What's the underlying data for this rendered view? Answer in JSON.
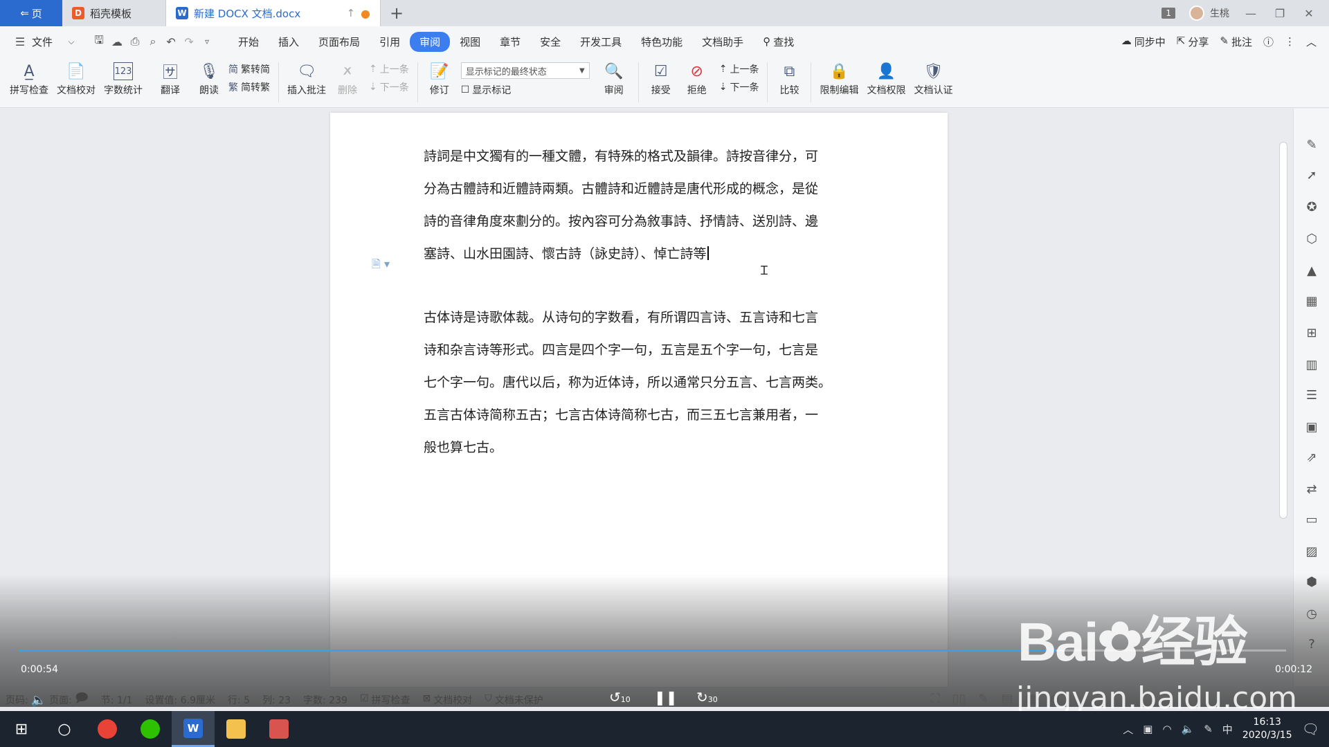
{
  "titlebar": {
    "home_tab": "页",
    "tabs": [
      {
        "label": "稻壳模板",
        "logo": "D"
      },
      {
        "label": "新建 DOCX 文档.docx",
        "logo": "W"
      }
    ],
    "add_tab": "+",
    "page_count_badge": "1",
    "user_name": "生桃",
    "window_minimize": "—",
    "window_restore": "❐",
    "window_close": "✕"
  },
  "menubar": {
    "file_label": "文件",
    "items": [
      "开始",
      "插入",
      "页面布局",
      "引用",
      "审阅",
      "视图",
      "章节",
      "安全",
      "开发工具",
      "特色功能",
      "文档助手"
    ],
    "active": "审阅",
    "search_label": "查找",
    "right": {
      "sync": "同步中",
      "share": "分享",
      "comment": "批注"
    }
  },
  "ribbon": {
    "spell_check": "拼写检查",
    "doc_proof": "文档校对",
    "word_count": "字数统计",
    "translate": "翻译",
    "read_aloud": "朗读",
    "trad_to_simp": "繁转简",
    "simp_to_trad": "简转繁",
    "insert_comment": "插入批注",
    "delete": "删除",
    "prev_comment": "上一条",
    "next_comment": "下一条",
    "revise": "修订",
    "display_state": "显示标记的最终状态",
    "show_markup": "显示标记",
    "review": "审阅",
    "accept": "接受",
    "reject": "拒绝",
    "prev": "上一条",
    "next": "下一条",
    "compare": "比较",
    "restrict_edit": "限制编辑",
    "doc_permission": "文档权限",
    "doc_certify": "文档认证"
  },
  "document": {
    "para1_lines": [
      "詩詞是中文獨有的一種文體，有特殊的格式及韻律。詩按音律分，可",
      "分為古體詩和近體詩兩類。古體詩和近體詩是唐代形成的概念，是從",
      "詩的音律角度來劃分的。按內容可分為敘事詩、抒情詩、送別詩、邊",
      "塞詩、山水田園詩、懷古詩（詠史詩）、悼亡詩等"
    ],
    "para2_lines": [
      "古体诗是诗歌体裁。从诗句的字数看，有所谓四言诗、五言诗和七言",
      "诗和杂言诗等形式。四言是四个字一句，五言是五个字一句，七言是",
      "七个字一句。唐代以后，称为近体诗，所以通常只分五言、七言两类。",
      "五言古体诗简称五古；七言古体诗简称七古，而三五七言兼用者，一",
      "般也算七古。"
    ]
  },
  "video": {
    "time_current": "0:00:54",
    "time_remaining": "0:00:12",
    "progress": 0.818,
    "rewind_seconds": "10",
    "forward_seconds": "30",
    "accent": "#3a9ef5"
  },
  "statusbar": {
    "page_label": "页码:",
    "page_label2": "页面:",
    "section": "节: 1/1",
    "setting": "设置值: 6.9厘米",
    "row": "行: 5",
    "col": "列: 23",
    "word_count": "字数: 239",
    "spell_check": "拼写检查",
    "doc_proof": "文档校对",
    "unprotected": "文档未保护"
  },
  "watermark": {
    "brand": "Bai",
    "brand_suffix": "经验",
    "url": "jingyan.baidu.com"
  },
  "taskbar": {
    "ime": "中",
    "time": "16:13",
    "date": "2020/3/15"
  },
  "colors": {
    "accent": "#3c7ef0",
    "home_tab": "#2b6bcf",
    "taskbar": "#1c2430"
  }
}
